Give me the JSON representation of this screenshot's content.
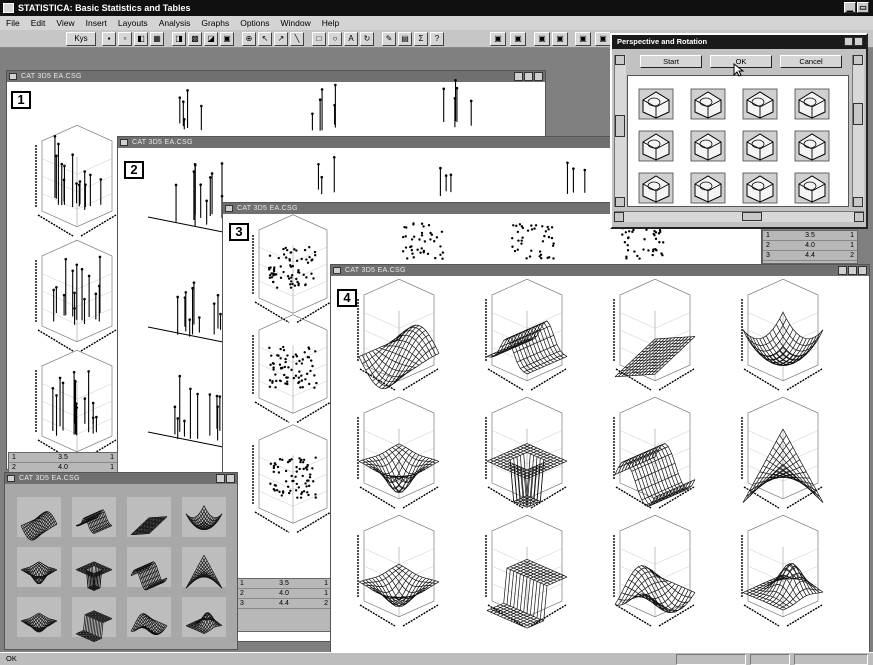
{
  "app": {
    "title": "STATISTICA: Basic Statistics and Tables",
    "menu": [
      "File",
      "Edit",
      "View",
      "Insert",
      "Layouts",
      "Analysis",
      "Graphs",
      "Options",
      "Window",
      "Help"
    ],
    "toolbar_labels": {
      "style_box": "Kys"
    }
  },
  "windows": [
    {
      "title": "CAT 3D5 EA.CSG",
      "label": "1"
    },
    {
      "title": "CAT 3D5 EA.CSG",
      "label": "2"
    },
    {
      "title": "CAT 3D5 EA.CSG",
      "label": "3"
    },
    {
      "title": "CAT 3D5 EA.CSG",
      "label": "4"
    }
  ],
  "thumbnail_window": {
    "title": "CAT 3D5 EA.CSG"
  },
  "dialog": {
    "title": "Perspective and Rotation",
    "buttons": {
      "start": "Start",
      "ok": "OK",
      "cancel": "Cancel"
    }
  },
  "spread_rows": [
    [
      "1",
      "3.5",
      "1"
    ],
    [
      "2",
      "4.0",
      "1"
    ],
    [
      "3",
      "4.4",
      "2"
    ]
  ],
  "status": {
    "left": "OK",
    "right1": "",
    "right2": ""
  },
  "colors": {
    "titlebar": "#101010",
    "window_caption": "#707070",
    "face": "#c6c6c6",
    "plot_ink": "#000000"
  }
}
